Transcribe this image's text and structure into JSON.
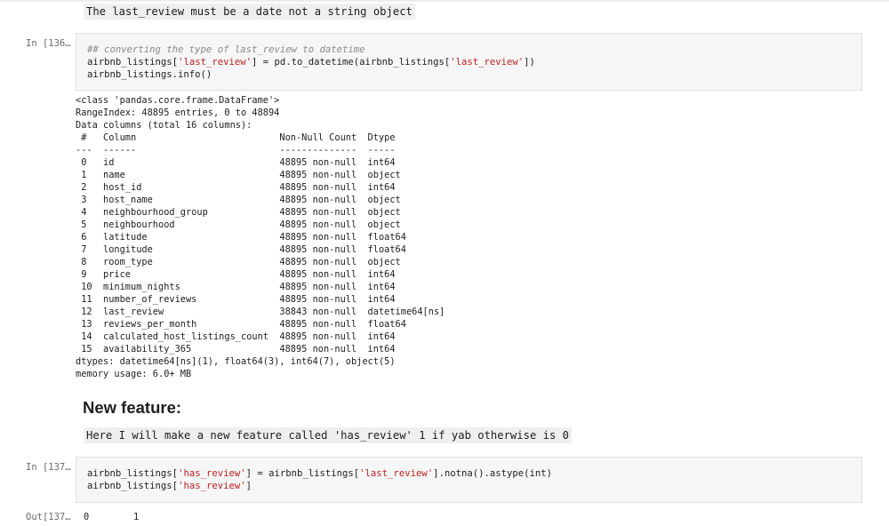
{
  "markdown1": {
    "text": "The last_review must be a date not a string object"
  },
  "cell1": {
    "prompt": "In [136…",
    "lines": [
      [
        {
          "t": "## converting the type of last_review to datetime",
          "c": "cm"
        }
      ],
      [
        {
          "t": "airbnb_listings[",
          "c": ""
        },
        {
          "t": "'last_review'",
          "c": "st"
        },
        {
          "t": "] = pd.to_datetime(airbnb_listings[",
          "c": ""
        },
        {
          "t": "'last_review'",
          "c": "st"
        },
        {
          "t": "])",
          "c": ""
        }
      ],
      [
        {
          "t": "airbnb_listings.info()",
          "c": ""
        }
      ]
    ]
  },
  "output1": {
    "lines": [
      "<class 'pandas.core.frame.DataFrame'>",
      "RangeIndex: 48895 entries, 0 to 48894",
      "Data columns (total 16 columns):",
      " #   Column                          Non-Null Count  Dtype",
      "---  ------                          --------------  -----",
      " 0   id                              48895 non-null  int64",
      " 1   name                            48895 non-null  object",
      " 2   host_id                         48895 non-null  int64",
      " 3   host_name                       48895 non-null  object",
      " 4   neighbourhood_group             48895 non-null  object",
      " 5   neighbourhood                   48895 non-null  object",
      " 6   latitude                        48895 non-null  float64",
      " 7   longitude                       48895 non-null  float64",
      " 8   room_type                       48895 non-null  object",
      " 9   price                           48895 non-null  int64",
      " 10  minimum_nights                  48895 non-null  int64",
      " 11  number_of_reviews               48895 non-null  int64",
      " 12  last_review                     38843 non-null  datetime64[ns]",
      " 13  reviews_per_month               48895 non-null  float64",
      " 14  calculated_host_listings_count  48895 non-null  int64",
      " 15  availability_365                48895 non-null  int64",
      "dtypes: datetime64[ns](1), float64(3), int64(7), object(5)",
      "memory usage: 6.0+ MB"
    ]
  },
  "heading": {
    "text": "New feature:"
  },
  "markdown2": {
    "text": "Here I will make a new feature called 'has_review' 1 if yab otherwise is 0"
  },
  "cell2": {
    "prompt": "In [137…",
    "lines": [
      [
        {
          "t": "airbnb_listings[",
          "c": ""
        },
        {
          "t": "'has_review'",
          "c": "st"
        },
        {
          "t": "] = airbnb_listings[",
          "c": ""
        },
        {
          "t": "'last_review'",
          "c": "st"
        },
        {
          "t": "].notna().astype(int)",
          "c": ""
        }
      ],
      [
        {
          "t": "airbnb_listings[",
          "c": ""
        },
        {
          "t": "'has_review'",
          "c": "st"
        },
        {
          "t": "]",
          "c": ""
        }
      ]
    ]
  },
  "output2": {
    "prompt": "Out[137…",
    "index": "0",
    "value": "1"
  }
}
